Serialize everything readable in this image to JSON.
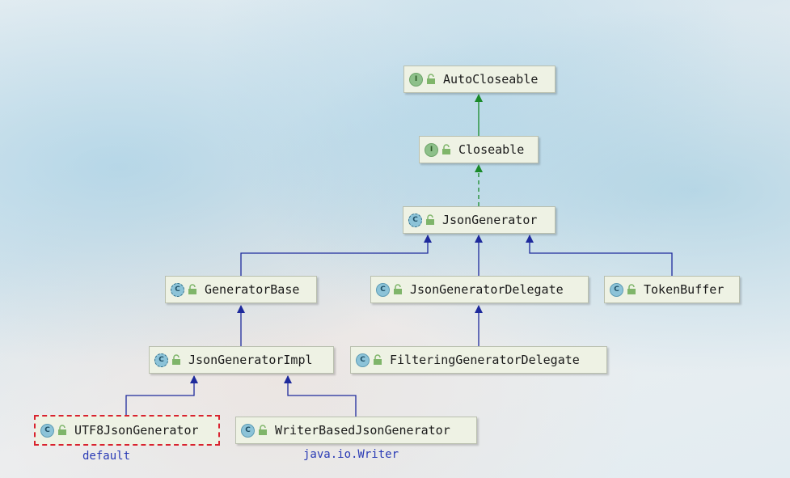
{
  "nodes": [
    {
      "id": "AutoCloseable",
      "label": "AutoCloseable",
      "kind": "interface",
      "kind_letter": "I",
      "icon": "interface-icon"
    },
    {
      "id": "Closeable",
      "label": "Closeable",
      "kind": "interface",
      "kind_letter": "I",
      "icon": "interface-icon"
    },
    {
      "id": "JsonGenerator",
      "label": "JsonGenerator",
      "kind": "abstract-class",
      "kind_letter": "C",
      "icon": "abstract-class-icon"
    },
    {
      "id": "GeneratorBase",
      "label": "GeneratorBase",
      "kind": "abstract-class",
      "kind_letter": "C",
      "icon": "abstract-class-icon"
    },
    {
      "id": "JsonGeneratorDelegate",
      "label": "JsonGeneratorDelegate",
      "kind": "class",
      "kind_letter": "C",
      "icon": "class-icon"
    },
    {
      "id": "TokenBuffer",
      "label": "TokenBuffer",
      "kind": "class",
      "kind_letter": "C",
      "icon": "class-icon"
    },
    {
      "id": "JsonGeneratorImpl",
      "label": "JsonGeneratorImpl",
      "kind": "abstract-class",
      "kind_letter": "C",
      "icon": "abstract-class-icon"
    },
    {
      "id": "FilteringGeneratorDelegate",
      "label": "FilteringGeneratorDelegate",
      "kind": "class",
      "kind_letter": "C",
      "icon": "class-icon"
    },
    {
      "id": "UTF8JsonGenerator",
      "label": "UTF8JsonGenerator",
      "kind": "class",
      "kind_letter": "C",
      "icon": "class-icon",
      "selected": true
    },
    {
      "id": "WriterBasedJsonGenerator",
      "label": "WriterBasedJsonGenerator",
      "kind": "class",
      "kind_letter": "C",
      "icon": "class-icon"
    }
  ],
  "edges": [
    {
      "from": "Closeable",
      "to": "AutoCloseable",
      "type": "extends",
      "color": "#1a8a2a"
    },
    {
      "from": "JsonGenerator",
      "to": "Closeable",
      "type": "implements",
      "color": "#1a8a2a"
    },
    {
      "from": "GeneratorBase",
      "to": "JsonGenerator",
      "type": "extends",
      "color": "#1e2a9c"
    },
    {
      "from": "JsonGeneratorDelegate",
      "to": "JsonGenerator",
      "type": "extends",
      "color": "#1e2a9c"
    },
    {
      "from": "TokenBuffer",
      "to": "JsonGenerator",
      "type": "extends",
      "color": "#1e2a9c"
    },
    {
      "from": "JsonGeneratorImpl",
      "to": "GeneratorBase",
      "type": "extends",
      "color": "#1e2a9c"
    },
    {
      "from": "FilteringGeneratorDelegate",
      "to": "JsonGeneratorDelegate",
      "type": "extends",
      "color": "#1e2a9c"
    },
    {
      "from": "UTF8JsonGenerator",
      "to": "JsonGeneratorImpl",
      "type": "extends",
      "color": "#1e2a9c"
    },
    {
      "from": "WriterBasedJsonGenerator",
      "to": "JsonGeneratorImpl",
      "type": "extends",
      "color": "#1e2a9c"
    }
  ],
  "notes": {
    "utf8": "default",
    "writer": "java.io.Writer"
  },
  "colors": {
    "inheritance_edge": "#1e2a9c",
    "interface_edge": "#1a8a2a",
    "selection_border": "#d9232f",
    "note_text": "#2a3bb5"
  }
}
